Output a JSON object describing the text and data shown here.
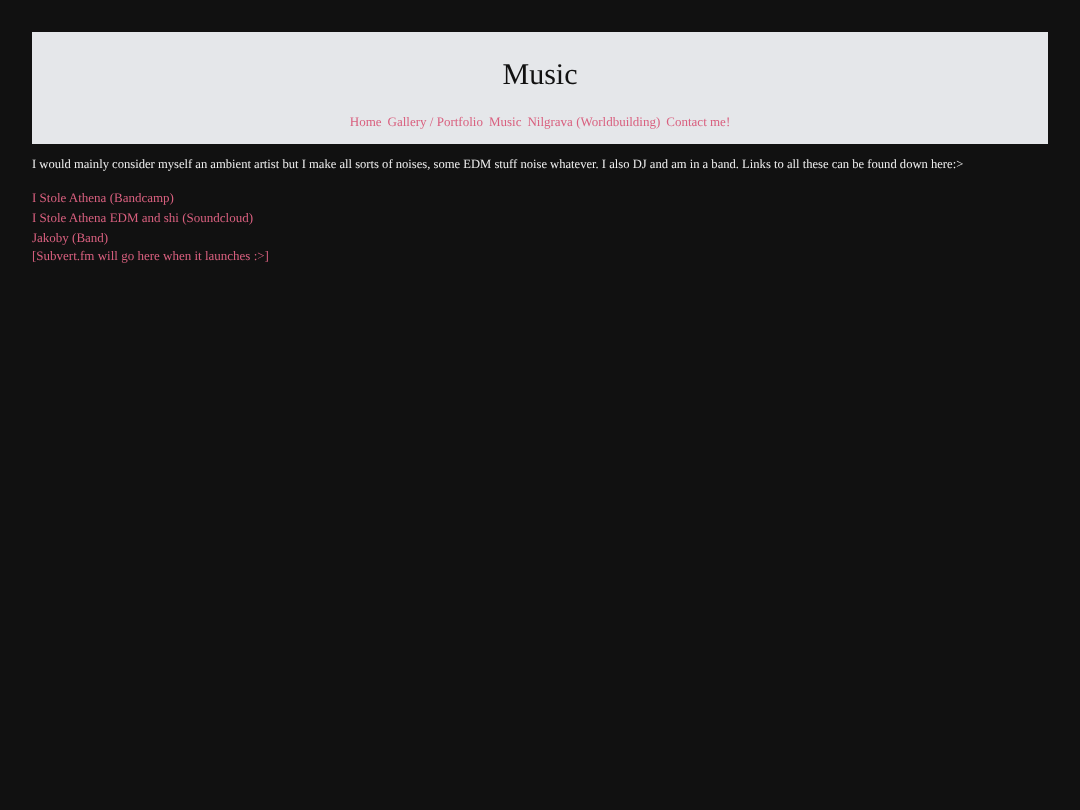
{
  "header": {
    "title": "Music",
    "nav": [
      "Home",
      "Gallery / Portfolio",
      "Music",
      "Nilgrava (Worldbuilding)",
      "Contact me!"
    ]
  },
  "intro": "I would mainly consider myself an ambient artist but I make all sorts of noises, some EDM stuff noise whatever. I also DJ and am in a band. Links to all these can be found down here:>",
  "links": [
    "I Stole Athena (Bandcamp)",
    "I Stole Athena EDM and shi (Soundcloud)",
    "Jakoby (Band)",
    "[Subvert.fm will go here when it launches :>]"
  ]
}
